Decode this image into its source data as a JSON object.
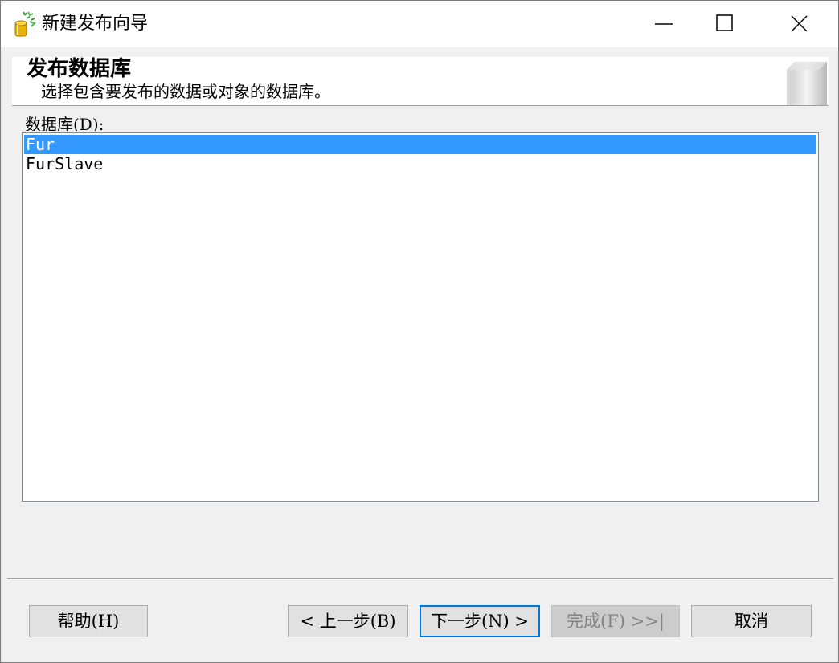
{
  "window": {
    "title": "新建发布向导",
    "icon": "publication-wizard-icon"
  },
  "header": {
    "title": "发布数据库",
    "subtitle": "选择包含要发布的数据或对象的数据库。"
  },
  "database_list": {
    "label": "数据库(D):",
    "items": [
      {
        "name": "Fur",
        "selected": true
      },
      {
        "name": "FurSlave",
        "selected": false
      }
    ],
    "selection_color": "#3399ff"
  },
  "buttons": {
    "help": "帮助(H)",
    "back": "< 上一步(B)",
    "next": "下一步(N) >",
    "finish": "完成(F) >>|",
    "cancel": "取消"
  }
}
